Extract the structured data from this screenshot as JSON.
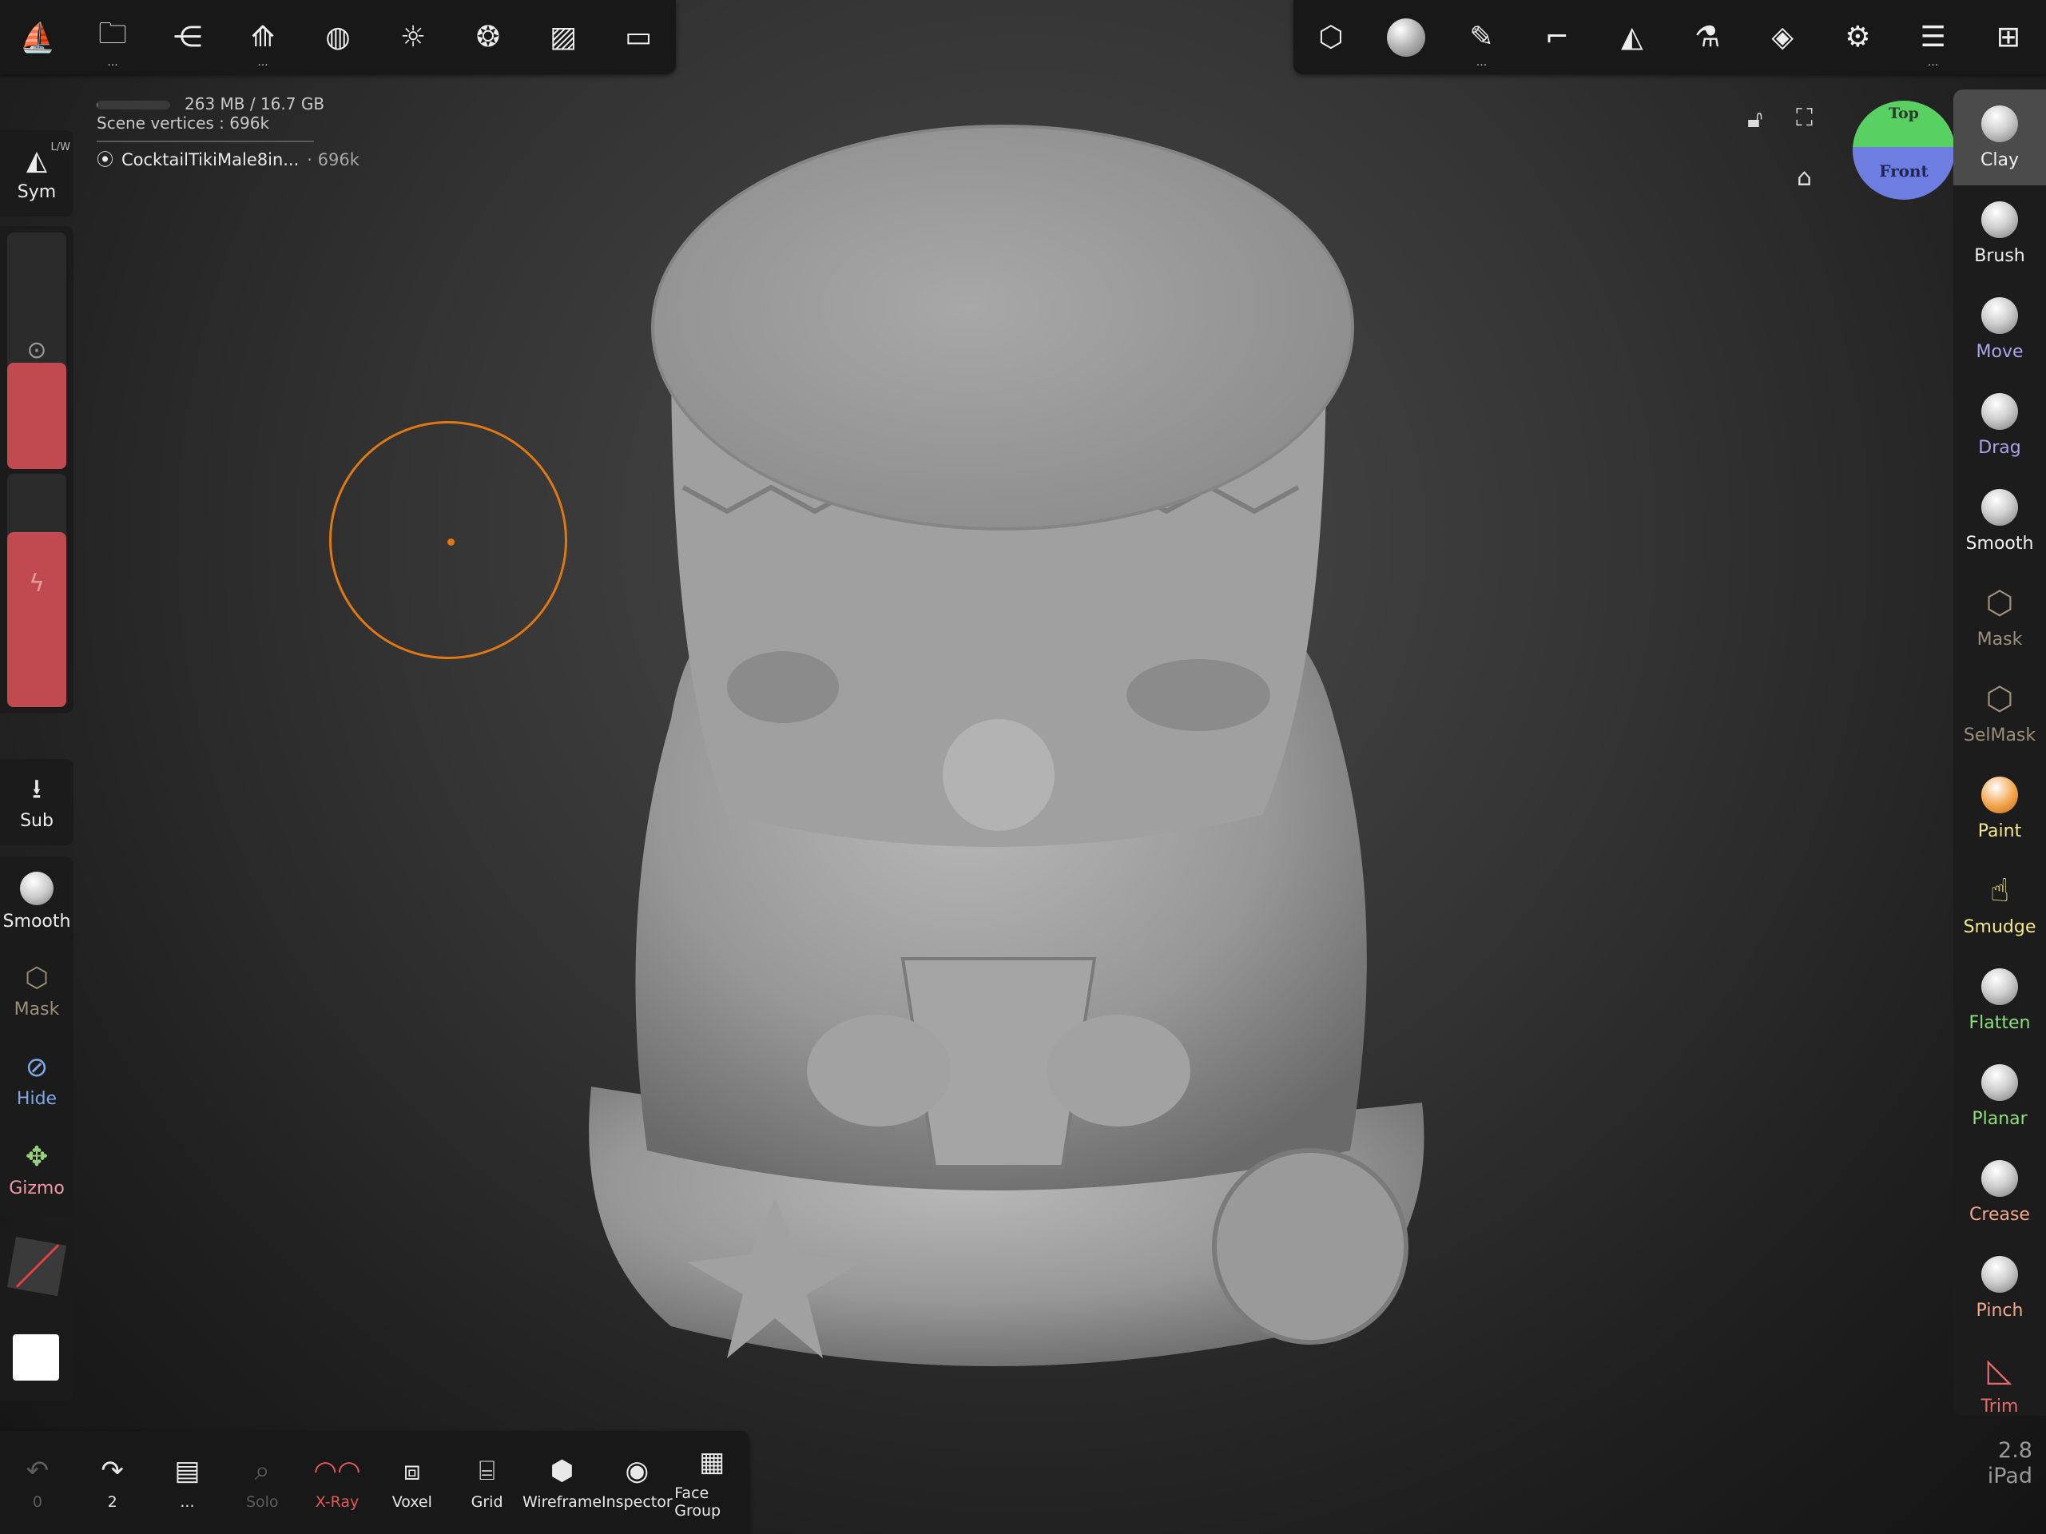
{
  "top_left_toolbar": [
    {
      "name": "nomad-logo-icon",
      "glyph": "⛵",
      "dots": false
    },
    {
      "name": "folder-icon",
      "glyph": "🗀",
      "dots": true
    },
    {
      "name": "scene-graph-icon",
      "glyph": "⋲",
      "dots": false
    },
    {
      "name": "mesh-topology-icon",
      "glyph": "⟰",
      "dots": true
    },
    {
      "name": "material-sphere-icon",
      "glyph": "◍",
      "dots": false
    },
    {
      "name": "light-sun-icon",
      "glyph": "☼",
      "dots": false
    },
    {
      "name": "camera-aperture-icon",
      "glyph": "❂",
      "dots": false
    },
    {
      "name": "background-image-icon",
      "glyph": "▨",
      "dots": false
    },
    {
      "name": "video-camera-icon",
      "glyph": "▭",
      "dots": false
    }
  ],
  "top_right_toolbar": [
    {
      "name": "display-cube-icon",
      "glyph": "⬡",
      "dots": false
    },
    {
      "name": "brush-material-sphere-icon",
      "glyph": "",
      "dots": false
    },
    {
      "name": "stroke-pen-icon",
      "glyph": "✎",
      "dots": true
    },
    {
      "name": "painting-tool-icon",
      "glyph": "⌐",
      "dots": false
    },
    {
      "name": "symmetry-mirror-icon",
      "glyph": "◭",
      "dots": false
    },
    {
      "name": "flask-icon",
      "glyph": "⚗",
      "dots": false
    },
    {
      "name": "layers-icon",
      "glyph": "◈",
      "dots": false
    },
    {
      "name": "settings-gear-icon",
      "glyph": "⚙",
      "dots": false
    },
    {
      "name": "sliders-icon",
      "glyph": "☰",
      "dots": true
    },
    {
      "name": "gift-box-icon",
      "glyph": "⊞",
      "dots": false
    }
  ],
  "info": {
    "memory": "263 MB / 16.7 GB",
    "memory_used_fraction": 0.016,
    "vertices": "Scene vertices : 696k",
    "mesh_name": "CocktailTikiMale8in...",
    "mesh_count": "· 696k"
  },
  "left_panel": {
    "sym_label": "Sym",
    "sym_badge": "L/W",
    "radius_fill": 0.45,
    "intensity_fill": 0.75,
    "sub_label": "Sub",
    "smooth_label": "Smooth",
    "mask_label": "Mask",
    "hide_label": "Hide",
    "gizmo_label": "Gizmo"
  },
  "right_tools": [
    {
      "label": "Clay",
      "color": "#f0f0f0",
      "kind": "ball",
      "active": true
    },
    {
      "label": "Brush",
      "color": "#f0f0f0",
      "kind": "ball",
      "active": false
    },
    {
      "label": "Move",
      "color": "#a9a3ea",
      "kind": "ball",
      "active": false
    },
    {
      "label": "Drag",
      "color": "#a9a3ea",
      "kind": "ball",
      "active": false
    },
    {
      "label": "Smooth",
      "color": "#f0f0f0",
      "kind": "ball",
      "active": false
    },
    {
      "label": "Mask",
      "color": "#9b8e7a",
      "kind": "glyph",
      "glyph": "⬡",
      "active": false
    },
    {
      "label": "SelMask",
      "color": "#9b8e7a",
      "kind": "glyph",
      "glyph": "⬡",
      "active": false
    },
    {
      "label": "Paint",
      "color": "#f4e98a",
      "kind": "ball",
      "active": false
    },
    {
      "label": "Smudge",
      "color": "#f4e98a",
      "kind": "glyph",
      "glyph": "☝",
      "active": false
    },
    {
      "label": "Flatten",
      "color": "#8fe07a",
      "kind": "ball",
      "active": false
    },
    {
      "label": "Planar",
      "color": "#8fe07a",
      "kind": "ball",
      "active": false
    },
    {
      "label": "Crease",
      "color": "#f0a98a",
      "kind": "ball",
      "active": false
    },
    {
      "label": "Pinch",
      "color": "#f0a98a",
      "kind": "ball",
      "active": false
    },
    {
      "label": "Trim",
      "color": "#e66a6a",
      "kind": "glyph",
      "glyph": "◺",
      "active": false
    }
  ],
  "bottom_toolbar": [
    {
      "name": "undo",
      "label": "0",
      "glyph": "↶",
      "disabled": true
    },
    {
      "name": "redo",
      "label": "2",
      "glyph": "↷",
      "disabled": false
    },
    {
      "name": "history",
      "label": "...",
      "glyph": "▤",
      "disabled": false
    },
    {
      "name": "solo",
      "label": "Solo",
      "glyph": "⌕",
      "disabled": true
    },
    {
      "name": "x-ray",
      "label": "X-Ray",
      "glyph": "◠◠",
      "disabled": false,
      "color": "#e05a55"
    },
    {
      "name": "voxel",
      "label": "Voxel",
      "glyph": "⧈",
      "disabled": false
    },
    {
      "name": "grid",
      "label": "Grid",
      "glyph": "⌸",
      "disabled": false
    },
    {
      "name": "wireframe",
      "label": "Wireframe",
      "glyph": "⬢",
      "disabled": false
    },
    {
      "name": "inspector",
      "label": "Inspector",
      "glyph": "◉",
      "disabled": false
    },
    {
      "name": "face-group",
      "label": "Face Group",
      "glyph": "▦",
      "disabled": false
    }
  ],
  "view_cube": {
    "top": "Top",
    "front": "Front"
  },
  "version": {
    "number": "2.8",
    "device": "iPad"
  },
  "colors": {
    "accent_red": "#c04a50",
    "brush_ring": "#e07812",
    "panel_bg": "#1b1b1b",
    "model_gray": "#9c9c9c"
  }
}
